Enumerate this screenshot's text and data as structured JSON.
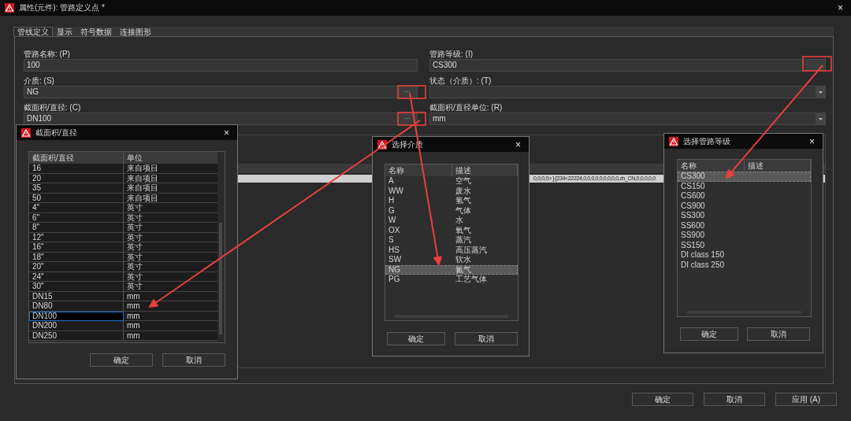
{
  "window": {
    "title": "属性(元件): 管路定义点 *",
    "close": "×"
  },
  "tabs": [
    {
      "label": "管线定义",
      "selected": true
    },
    {
      "label": "显示",
      "selected": false
    },
    {
      "label": "符号数据",
      "selected": false
    },
    {
      "label": "连接图形",
      "selected": false
    }
  ],
  "fields_left": [
    {
      "label": "管路名称: (P)",
      "value": "100",
      "kind": "text"
    },
    {
      "label": "介质: (S)",
      "value": "NG",
      "kind": "browse",
      "button_text": "···"
    },
    {
      "label": "截面积/直径: (C)",
      "value": "DN100",
      "kind": "browse",
      "button_text": "···"
    }
  ],
  "fields_right": [
    {
      "label": "管路等级: (I)",
      "value": "CS300",
      "kind": "browse"
    },
    {
      "label": "状态（介质）: (T)",
      "kind": "dropdown"
    },
    {
      "label": "截面积/直径单位: (R)",
      "value": "mm",
      "kind": "dropdown"
    }
  ],
  "background_strip_text": "0,0,0,0> ]-[234<22224,0,0,0,0,0,0,0,0,0,zh_CN,0,0,0,0,0",
  "dialogs": [
    {
      "title": "截面积/直径",
      "close": "×",
      "columns": [
        "截面积/直径",
        "单位"
      ],
      "kind": "grid",
      "rows": [
        {
          "cells": [
            "16",
            "来自项目"
          ],
          "selected": false
        },
        {
          "cells": [
            "20",
            "来自项目"
          ],
          "selected": false
        },
        {
          "cells": [
            "35",
            "来自项目"
          ],
          "selected": false
        },
        {
          "cells": [
            "50",
            "来自项目"
          ],
          "selected": false
        },
        {
          "cells": [
            "4\"",
            "英寸"
          ],
          "selected": false
        },
        {
          "cells": [
            "6\"",
            "英寸"
          ],
          "selected": false
        },
        {
          "cells": [
            "8\"",
            "英寸"
          ],
          "selected": false
        },
        {
          "cells": [
            "12\"",
            "英寸"
          ],
          "selected": false
        },
        {
          "cells": [
            "16\"",
            "英寸"
          ],
          "selected": false
        },
        {
          "cells": [
            "18\"",
            "英寸"
          ],
          "selected": false
        },
        {
          "cells": [
            "20\"",
            "英寸"
          ],
          "selected": false
        },
        {
          "cells": [
            "24\"",
            "英寸"
          ],
          "selected": false
        },
        {
          "cells": [
            "30\"",
            "英寸"
          ],
          "selected": false
        },
        {
          "cells": [
            "DN15",
            "mm"
          ],
          "selected": false
        },
        {
          "cells": [
            "DN80",
            "mm"
          ],
          "selected": false
        },
        {
          "cells": [
            "DN100",
            "mm"
          ],
          "selected": true
        },
        {
          "cells": [
            "DN200",
            "mm"
          ],
          "selected": false
        },
        {
          "cells": [
            "DN250",
            "mm"
          ],
          "selected": false
        }
      ],
      "buttons": [
        "确定",
        "取消"
      ]
    },
    {
      "title": "选择介质",
      "close": "×",
      "columns": [
        "名称",
        "描述"
      ],
      "kind": "list",
      "rows": [
        {
          "cells": [
            "A",
            "空气"
          ],
          "selected": false
        },
        {
          "cells": [
            "WW",
            "废水"
          ],
          "selected": false
        },
        {
          "cells": [
            "H",
            "氢气"
          ],
          "selected": false
        },
        {
          "cells": [
            "G",
            "气体"
          ],
          "selected": false
        },
        {
          "cells": [
            "W",
            "水"
          ],
          "selected": false
        },
        {
          "cells": [
            "OX",
            "氧气"
          ],
          "selected": false
        },
        {
          "cells": [
            "S",
            "蒸汽"
          ],
          "selected": false
        },
        {
          "cells": [
            "HS",
            "高压蒸汽"
          ],
          "selected": false
        },
        {
          "cells": [
            "SW",
            "软水"
          ],
          "selected": false
        },
        {
          "cells": [
            "NG",
            "氮气"
          ],
          "selected": true
        },
        {
          "cells": [
            "PG",
            "工艺气体"
          ],
          "selected": false
        }
      ],
      "buttons": [
        "确定",
        "取消"
      ]
    },
    {
      "title": "选择管路等级",
      "close": "×",
      "columns": [
        "名称",
        "描述"
      ],
      "kind": "list",
      "rows": [
        {
          "cells": [
            "CS300"
          ],
          "selected": true
        },
        {
          "cells": [
            "CS150"
          ],
          "selected": false
        },
        {
          "cells": [
            "CS600"
          ],
          "selected": false
        },
        {
          "cells": [
            "CS900"
          ],
          "selected": false
        },
        {
          "cells": [
            "SS300"
          ],
          "selected": false
        },
        {
          "cells": [
            "SS600"
          ],
          "selected": false
        },
        {
          "cells": [
            "SS900"
          ],
          "selected": false
        },
        {
          "cells": [
            "SS150"
          ],
          "selected": false
        },
        {
          "cells": [
            "DI class 150"
          ],
          "selected": false
        },
        {
          "cells": [
            "DI class 250"
          ],
          "selected": false
        }
      ],
      "buttons": [
        "确定",
        "取消"
      ]
    }
  ],
  "buttons": [
    "确定",
    "取消",
    "应用 (A)"
  ]
}
